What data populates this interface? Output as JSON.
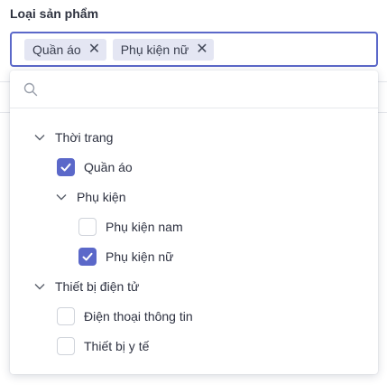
{
  "field": {
    "label": "Loại sản phẩm"
  },
  "selected_chips": [
    {
      "label": "Quần áo",
      "close_icon": "close-icon"
    },
    {
      "label": "Phụ kiện nữ",
      "close_icon": "close-icon"
    }
  ],
  "search": {
    "placeholder": "",
    "value": "",
    "icon": "search-icon"
  },
  "tree": [
    {
      "label": "Thời trang",
      "type": "group",
      "expanded": true
    },
    {
      "label": "Quần áo",
      "type": "item",
      "checked": true
    },
    {
      "label": "Phụ kiện",
      "type": "group",
      "expanded": true
    },
    {
      "label": "Phụ kiện nam",
      "type": "item",
      "checked": false
    },
    {
      "label": "Phụ kiện nữ",
      "type": "item",
      "checked": true
    },
    {
      "label": "Thiết bị điện tử",
      "type": "group",
      "expanded": true
    },
    {
      "label": "Điện thoại thông tin",
      "type": "item",
      "checked": false
    },
    {
      "label": "Thiết bị y tế",
      "type": "item",
      "checked": false
    }
  ],
  "colors": {
    "accent": "#5b68c9",
    "chip_bg": "#e4e6f3"
  }
}
